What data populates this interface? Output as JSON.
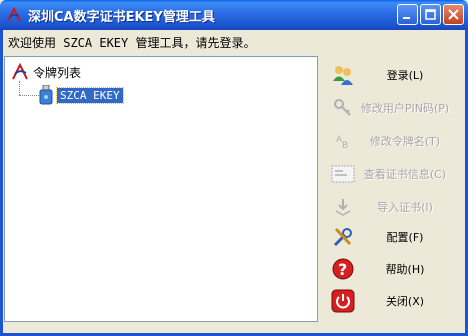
{
  "window": {
    "title": "深圳CA数字证书EKEY管理工具"
  },
  "welcome_text": "欢迎使用 SZCA EKEY 管理工具，请先登录。",
  "tree": {
    "root_label": "令牌列表",
    "items": [
      {
        "label": "SZCA EKEY",
        "selected": true
      }
    ]
  },
  "actions": [
    {
      "label": "登录(L)",
      "icon": "users-icon",
      "enabled": true
    },
    {
      "label": "修改用户PIN码(P)",
      "icon": "key-icon",
      "enabled": false
    },
    {
      "label": "修改令牌名(T)",
      "icon": "rename-icon",
      "enabled": false
    },
    {
      "label": "查看证书信息(C)",
      "icon": "certificate-icon",
      "enabled": false
    },
    {
      "label": "导入证书(I)",
      "icon": "import-icon",
      "enabled": false
    },
    {
      "label": "配置(F)",
      "icon": "tools-icon",
      "enabled": true
    },
    {
      "label": "帮助(H)",
      "icon": "help-icon",
      "enabled": true
    },
    {
      "label": "关闭(X)",
      "icon": "power-icon",
      "enabled": true
    }
  ],
  "colors": {
    "titlebar": "#1c54d1",
    "selection": "#316ac5",
    "window_bg": "#ece9d8"
  }
}
